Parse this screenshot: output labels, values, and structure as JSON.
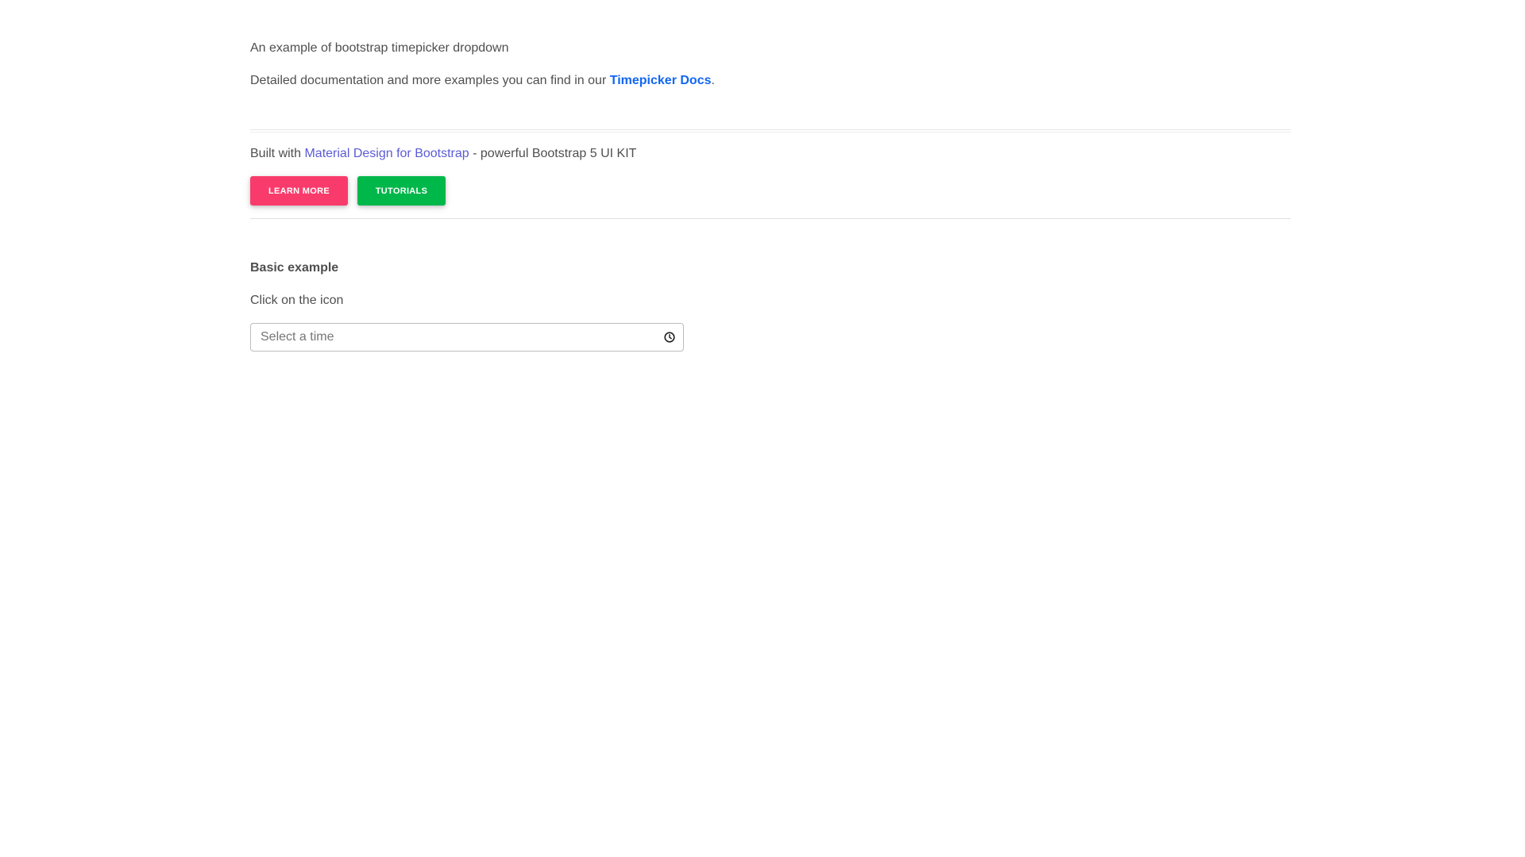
{
  "intro": {
    "text": "An example of bootstrap timepicker dropdown"
  },
  "docs": {
    "prefix": "Detailed documentation and more examples you can find in our ",
    "link_label": "Timepicker Docs",
    "suffix": "."
  },
  "promo": {
    "prefix": "Built with ",
    "link_label": "Material Design for Bootstrap",
    "suffix": " - powerful Bootstrap 5 UI KIT",
    "learn_more_label": "LEARN MORE",
    "tutorials_label": "TUTORIALS",
    "learn_more_color": "#f93b6b",
    "tutorials_color": "#00b74a",
    "link_color": "#5b5bd6"
  },
  "basic_example": {
    "title": "Basic example",
    "hint": "Click on the icon",
    "input_placeholder": "Select a time",
    "input_value": "",
    "icon": "clock-icon"
  },
  "colors": {
    "docs_link": "#1266f1",
    "text": "#4f4f4f"
  }
}
